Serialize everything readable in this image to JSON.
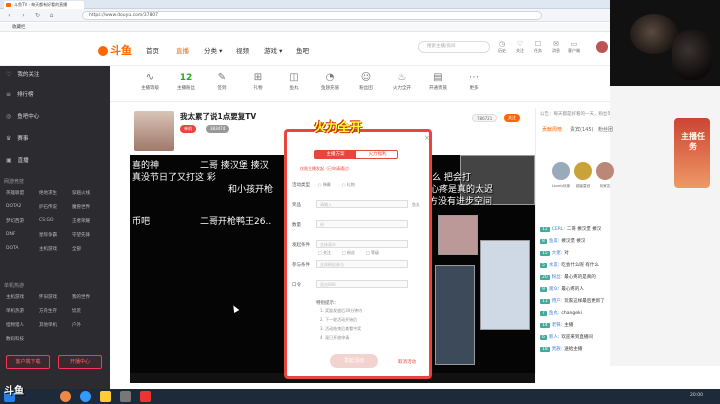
{
  "browser": {
    "tab_title": "斗鱼TV - 每天都有好看的直播",
    "url": "https://www.douyu.com/37807",
    "bookmark": "收藏栏"
  },
  "nav": {
    "logo": "斗鱼",
    "items": [
      "首页",
      "直播",
      "分类 ▾",
      "视频",
      "游戏 ▾",
      "鱼吧"
    ],
    "active": "直播",
    "search_placeholder": "搜索主播/房间",
    "icons": [
      {
        "label": "历史",
        "icon": "history-icon"
      },
      {
        "label": "关注",
        "icon": "follow-icon"
      },
      {
        "label": "任务",
        "icon": "task-icon"
      },
      {
        "label": "消息",
        "icon": "message-icon"
      },
      {
        "label": "客户端",
        "icon": "client-icon"
      },
      {
        "label": "开播",
        "icon": "broadcast-icon"
      }
    ]
  },
  "sidebar": {
    "items": [
      {
        "label": "我的关注",
        "icon": "heart-icon"
      },
      {
        "label": "排行榜",
        "icon": "rank-icon"
      },
      {
        "label": "鱼吧中心",
        "icon": "fish-icon"
      },
      {
        "label": "赛事",
        "icon": "trophy-icon"
      },
      {
        "label": "直播",
        "icon": "tv-icon"
      }
    ],
    "section1_title": "网游竞技",
    "section1_games": [
      "英雄联盟",
      "绝地求生",
      "穿越火线",
      "DOTA2",
      "炉石传说",
      "魔兽世界",
      "梦幻西游",
      "CS:GO",
      "王者荣耀",
      "DNF",
      "星际争霸",
      "守望先锋",
      "DOTA",
      "主机游戏",
      "全部"
    ],
    "section2_title": "单机热游",
    "section2_games": [
      "主机游戏",
      "怀旧游戏",
      "我的世界",
      "单机热游",
      "方舟生存",
      "饥荒",
      "怪物猎人",
      "其他单机",
      "户外",
      "数码科技"
    ],
    "btn_left": "客户端下载",
    "btn_right": "开播中心"
  },
  "categories": [
    {
      "label": "主播等级",
      "icon": "wave-icon",
      "value": ""
    },
    {
      "label": "主播粉丝",
      "icon": "",
      "value": "12"
    },
    {
      "label": "签到",
      "icon": "edit-icon",
      "value": ""
    },
    {
      "label": "礼物",
      "icon": "gift-icon",
      "value": ""
    },
    {
      "label": "鱼丸",
      "icon": "bag-icon",
      "value": ""
    },
    {
      "label": "鱼翅充值",
      "icon": "coin-icon",
      "value": ""
    },
    {
      "label": "粉丝团",
      "icon": "group-icon",
      "value": ""
    },
    {
      "label": "火力全开",
      "icon": "fire-icon",
      "value": ""
    },
    {
      "label": "开通贵族",
      "icon": "noble-icon",
      "value": ""
    },
    {
      "label": "更多",
      "icon": "more-icon",
      "value": ""
    }
  ],
  "room": {
    "title": "我太累了说1点要复TV",
    "category_tag": "单机",
    "follow_count": "786721",
    "follow_label": "关注",
    "hot": "383474"
  },
  "danmaku": [
    "喜的神",
    "二哥  揍汉堡  揍汉",
    "真没节日了又打这   彩",
    "和小孩开枪",
    "么  把会打",
    "心疼是真的太迟",
    "直方没有进步空间",
    "币吧",
    "二哥开枪鸭王26.."
  ],
  "modal": {
    "banner": "火力全开",
    "tab_active": "主播方案",
    "tab_other": "火力福利",
    "notice": "仅限主播发起（已申请通过）",
    "rows": [
      {
        "label": "活动类型",
        "value": "",
        "opts": [
          "弹幕",
          "礼物"
        ]
      },
      {
        "label": "奖品",
        "value": "请输入",
        "suffix": "鱼丸"
      },
      {
        "label": "数量",
        "value": "份"
      },
      {
        "label": "发起条件",
        "value": "全体观众",
        "opts": [
          "关注",
          "粉丝",
          "等级"
        ]
      },
      {
        "label": "参与条件",
        "value": "全体粉丝参与"
      },
      {
        "label": "口令",
        "value": "双击666"
      }
    ],
    "tips_title": "特别提示：",
    "tips": [
      "1. 奖励发放后30分钟内",
      "2. 下一轮活动开始后",
      "3. 活动结束后查看中奖",
      "4. 现已开放申请"
    ],
    "submit": "发起活动",
    "cancel": "取消活动"
  },
  "right": {
    "notice": "公告：每天都是好看的一天，粉丝等级达到5级",
    "tabs": [
      "贡献周榜",
      "贵宾(145)",
      "粉丝团"
    ],
    "ranks": [
      {
        "name": "Lovely玩家"
      },
      {
        "name": "超级皇冠"
      },
      {
        "name": "玩家名"
      }
    ],
    "chat": [
      {
        "lv": "12",
        "name": "CERL",
        "text": "二哥 揍汉堡 揍汉"
      },
      {
        "lv": "8",
        "name": "鱼友",
        "text": "揍汉堡 揍汉"
      },
      {
        "lv": "15",
        "name": "大佬",
        "text": "对"
      },
      {
        "lv": "5",
        "name": "水友",
        "text": "吃会什么呢 有什么"
      },
      {
        "lv": "20",
        "name": "粉丝",
        "text": "最心疼的是真的"
      },
      {
        "lv": "9",
        "name": "观众",
        "text": "最心疼的人"
      },
      {
        "lv": "11",
        "name": "用户",
        "text": "玩家这样最后更新了"
      },
      {
        "lv": "7",
        "name": "鱼丸",
        "text": "changeki"
      },
      {
        "lv": "14",
        "name": "老铁",
        "text": "主播"
      },
      {
        "lv": "6",
        "name": "新人",
        "text": "欢迎来到直播间"
      },
      {
        "lv": "18",
        "name": "贵族",
        "text": "送给主播"
      }
    ],
    "promo": "主播任务"
  },
  "watermark": "斗鱼",
  "taskbar": {
    "time": "20:00"
  }
}
